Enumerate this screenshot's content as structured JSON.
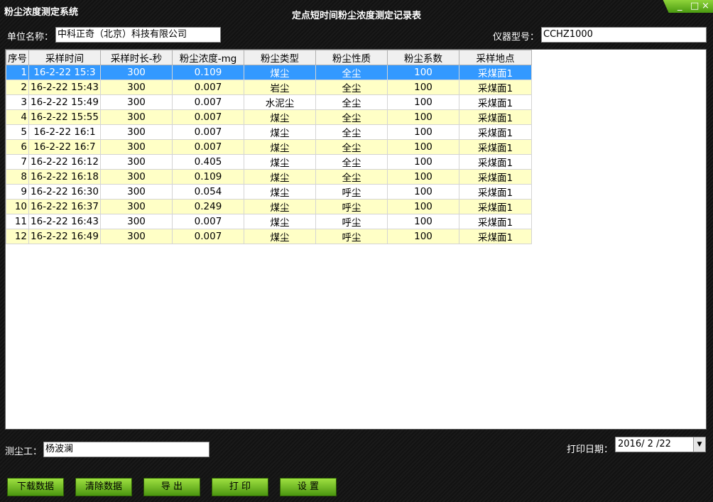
{
  "app": {
    "title": "粉尘浓度测定系统",
    "report_title": "定点短时间粉尘浓度测定记录表"
  },
  "window_controls": {
    "minimize": "_",
    "maximize": "□",
    "close": "×"
  },
  "header": {
    "unit_label": "单位名称：",
    "unit_value": "中科正奇（北京）科技有限公司",
    "model_label": "仪器型号：",
    "model_value": "CCHZ1000"
  },
  "table": {
    "columns": [
      "序号",
      "采样时间",
      "采样时长-秒",
      "粉尘浓度-mg",
      "粉尘类型",
      "粉尘性质",
      "粉尘系数",
      "采样地点"
    ],
    "rows": [
      [
        "1",
        "16-2-22 15:3",
        "300",
        "0.109",
        "煤尘",
        "全尘",
        "100",
        "采煤面1"
      ],
      [
        "2",
        "16-2-22 15:43",
        "300",
        "0.007",
        "岩尘",
        "全尘",
        "100",
        "采煤面1"
      ],
      [
        "3",
        "16-2-22 15:49",
        "300",
        "0.007",
        "水泥尘",
        "全尘",
        "100",
        "采煤面1"
      ],
      [
        "4",
        "16-2-22 15:55",
        "300",
        "0.007",
        "煤尘",
        "全尘",
        "100",
        "采煤面1"
      ],
      [
        "5",
        "16-2-22 16:1",
        "300",
        "0.007",
        "煤尘",
        "全尘",
        "100",
        "采煤面1"
      ],
      [
        "6",
        "16-2-22 16:7",
        "300",
        "0.007",
        "煤尘",
        "全尘",
        "100",
        "采煤面1"
      ],
      [
        "7",
        "16-2-22 16:12",
        "300",
        "0.405",
        "煤尘",
        "全尘",
        "100",
        "采煤面1"
      ],
      [
        "8",
        "16-2-22 16:18",
        "300",
        "0.109",
        "煤尘",
        "全尘",
        "100",
        "采煤面1"
      ],
      [
        "9",
        "16-2-22 16:30",
        "300",
        "0.054",
        "煤尘",
        "呼尘",
        "100",
        "采煤面1"
      ],
      [
        "10",
        "16-2-22 16:37",
        "300",
        "0.249",
        "煤尘",
        "呼尘",
        "100",
        "采煤面1"
      ],
      [
        "11",
        "16-2-22 16:43",
        "300",
        "0.007",
        "煤尘",
        "呼尘",
        "100",
        "采煤面1"
      ],
      [
        "12",
        "16-2-22 16:49",
        "300",
        "0.007",
        "煤尘",
        "呼尘",
        "100",
        "采煤面1"
      ]
    ],
    "selected_row": 0
  },
  "footer": {
    "tester_label": "测尘工：",
    "tester_value": "杨波澜",
    "print_date_label": "打印日期：",
    "print_date_value": "2016/ 2 /22"
  },
  "buttons": {
    "download": "下载数据",
    "clear": "清除数据",
    "export": "导 出",
    "print": "打 印",
    "settings": "设 置"
  },
  "colors": {
    "accent": "#6cc21f",
    "selected_row": "#3399ff",
    "alt_row": "#ffffc6"
  }
}
